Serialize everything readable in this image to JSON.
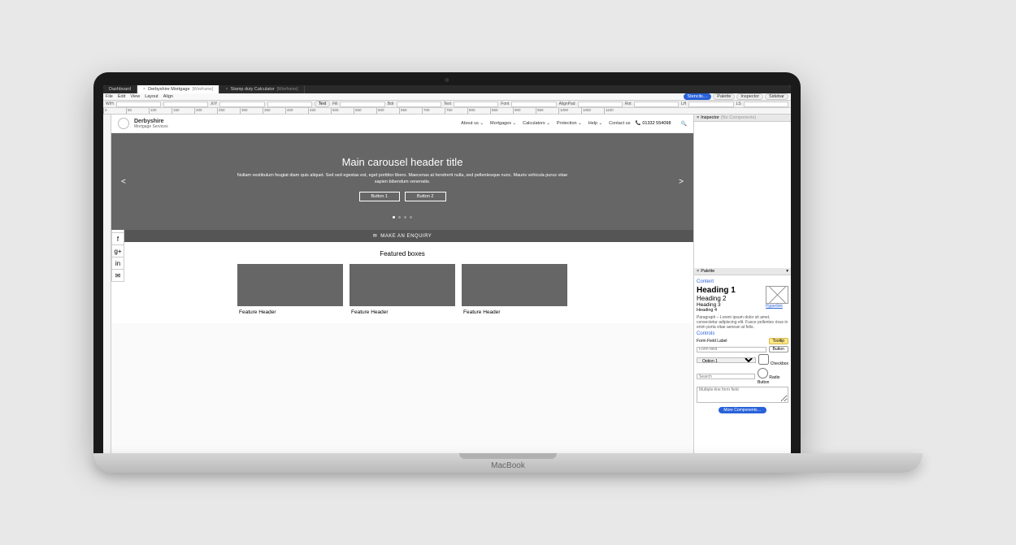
{
  "tabs": [
    {
      "label": "Dashboard",
      "active": false
    },
    {
      "label": "Derbyshire Mortgage",
      "suffix": "[Wireframe]",
      "active": true
    },
    {
      "label": "Stamp duty Calculator",
      "suffix": "[Wireframe]",
      "active": false
    }
  ],
  "menubar": {
    "items": [
      "File",
      "Edit",
      "View",
      "Layout",
      "Align"
    ],
    "right": [
      "Stencils…",
      "Palette",
      "Inspector",
      "Sidebar"
    ]
  },
  "toolbar": {
    "groups": [
      {
        "label": "W/H",
        "val": ""
      },
      {
        "label": "X/Y",
        "val": ""
      },
      {
        "label": "Fill",
        "val": ""
      },
      {
        "label": "Bdr",
        "val": ""
      },
      {
        "label": "Text",
        "val": ""
      },
      {
        "label": "Font",
        "val": ""
      },
      {
        "label": "AlignPad",
        "val": ""
      },
      {
        "label": "Rot",
        "val": ""
      },
      {
        "label": "LH",
        "val": ""
      },
      {
        "label": "LS",
        "val": ""
      }
    ],
    "textBtn": "Text"
  },
  "ruler_ticks": [
    "0",
    "50",
    "100",
    "150",
    "200",
    "250",
    "300",
    "350",
    "400",
    "450",
    "500",
    "550",
    "600",
    "650",
    "700",
    "750",
    "800",
    "850",
    "900",
    "950",
    "1000",
    "1050",
    "1100"
  ],
  "inspector": {
    "title": "Inspector",
    "note": "(No Components)"
  },
  "palette": {
    "title": "Palette",
    "content_label": "Content",
    "h1": "Heading 1",
    "h2": "Heading 2",
    "h3": "Heading 3",
    "h4": "Heading 4",
    "image_label": "Image",
    "hyperlink": "Hyperlink",
    "paragraph": "Paragraph – Lorem ipsum dolor sit amet, consectetur adipiscing elit. Fusce pellentes risus in enim porta vitae aenean at felis.",
    "controls_label": "Controls",
    "form_label": "Form Field Label",
    "tooltip": "Tooltip",
    "form_field": "Form field",
    "button": "Button",
    "option": "Option 1",
    "checkbox": "Checkbox",
    "search": "Search",
    "radio": "Radio Button",
    "multiline": "Multiple-line form field",
    "more": "More Components…"
  },
  "site": {
    "brand1": "Derbyshire",
    "brand2": "Mortgage Services",
    "nav": [
      "About us ⌄",
      "Mortgages ⌄",
      "Calculators ⌄",
      "Protection ⌄",
      "Help ⌄",
      "Contact us"
    ],
    "phone": "01332 554098",
    "carousel": {
      "title": "Main carousel header title",
      "text": "Nullam vestibulum feugiat diam quis aliquet. Sed sed egestas est, eget porttitor libero. Maecenas at hendrerit nulla, sed pellentesque nunc. Mauris vehicula purus vitae sapien bibendum venenatis.",
      "btn1": "Button 1",
      "btn2": "Button 2",
      "prev": "<",
      "next": ">"
    },
    "enquiry": "MAKE AN ENQUIRY",
    "featured": {
      "title": "Featured boxes",
      "box_header": "Feature Header"
    }
  },
  "laptop_brand": "MacBook"
}
